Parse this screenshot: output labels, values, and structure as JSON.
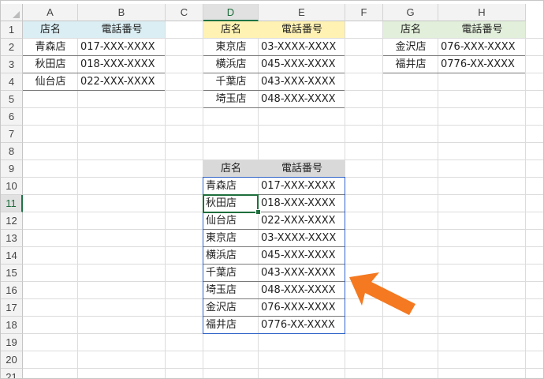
{
  "columns": [
    "A",
    "B",
    "C",
    "D",
    "E",
    "F",
    "G",
    "H"
  ],
  "rows": [
    "1",
    "2",
    "3",
    "4",
    "5",
    "6",
    "7",
    "8",
    "9",
    "10",
    "11",
    "12",
    "13",
    "14",
    "15",
    "16",
    "17",
    "18",
    "19",
    "20",
    "21"
  ],
  "selected_column": "D",
  "selected_row": "11",
  "colors": {
    "header_blue": "#daeef3",
    "header_yellow": "#fff2b3",
    "header_green": "#e2efda",
    "header_gray": "#d9d9d9",
    "selection_border": "#2f63c8",
    "active_cell_border": "#1f6f3d",
    "arrow": "#f47920"
  },
  "table_blue": {
    "header": [
      "店名",
      "電話番号"
    ],
    "rows": [
      [
        "青森店",
        "017-XXX-XXXX"
      ],
      [
        "秋田店",
        "018-XXX-XXXX"
      ],
      [
        "仙台店",
        "022-XXX-XXXX"
      ]
    ]
  },
  "table_yellow": {
    "header": [
      "店名",
      "電話番号"
    ],
    "rows": [
      [
        "東京店",
        "03-XXXX-XXXX"
      ],
      [
        "横浜店",
        "045-XXX-XXXX"
      ],
      [
        "千葉店",
        "043-XXX-XXXX"
      ],
      [
        "埼玉店",
        "048-XXX-XXXX"
      ]
    ]
  },
  "table_green": {
    "header": [
      "店名",
      "電話番号"
    ],
    "rows": [
      [
        "金沢店",
        "076-XXX-XXXX"
      ],
      [
        "福井店",
        "0776-XX-XXXX"
      ]
    ]
  },
  "table_merged": {
    "header": [
      "店名",
      "電話番号"
    ],
    "rows": [
      [
        "青森店",
        "017-XXX-XXXX"
      ],
      [
        "秋田店",
        "018-XXX-XXXX"
      ],
      [
        "仙台店",
        "022-XXX-XXXX"
      ],
      [
        "東京店",
        "03-XXXX-XXXX"
      ],
      [
        "横浜店",
        "045-XXX-XXXX"
      ],
      [
        "千葉店",
        "043-XXX-XXXX"
      ],
      [
        "埼玉店",
        "048-XXX-XXXX"
      ],
      [
        "金沢店",
        "076-XXX-XXXX"
      ],
      [
        "福井店",
        "0776-XX-XXXX"
      ]
    ]
  },
  "annotation": {
    "icon": "arrow-icon"
  }
}
